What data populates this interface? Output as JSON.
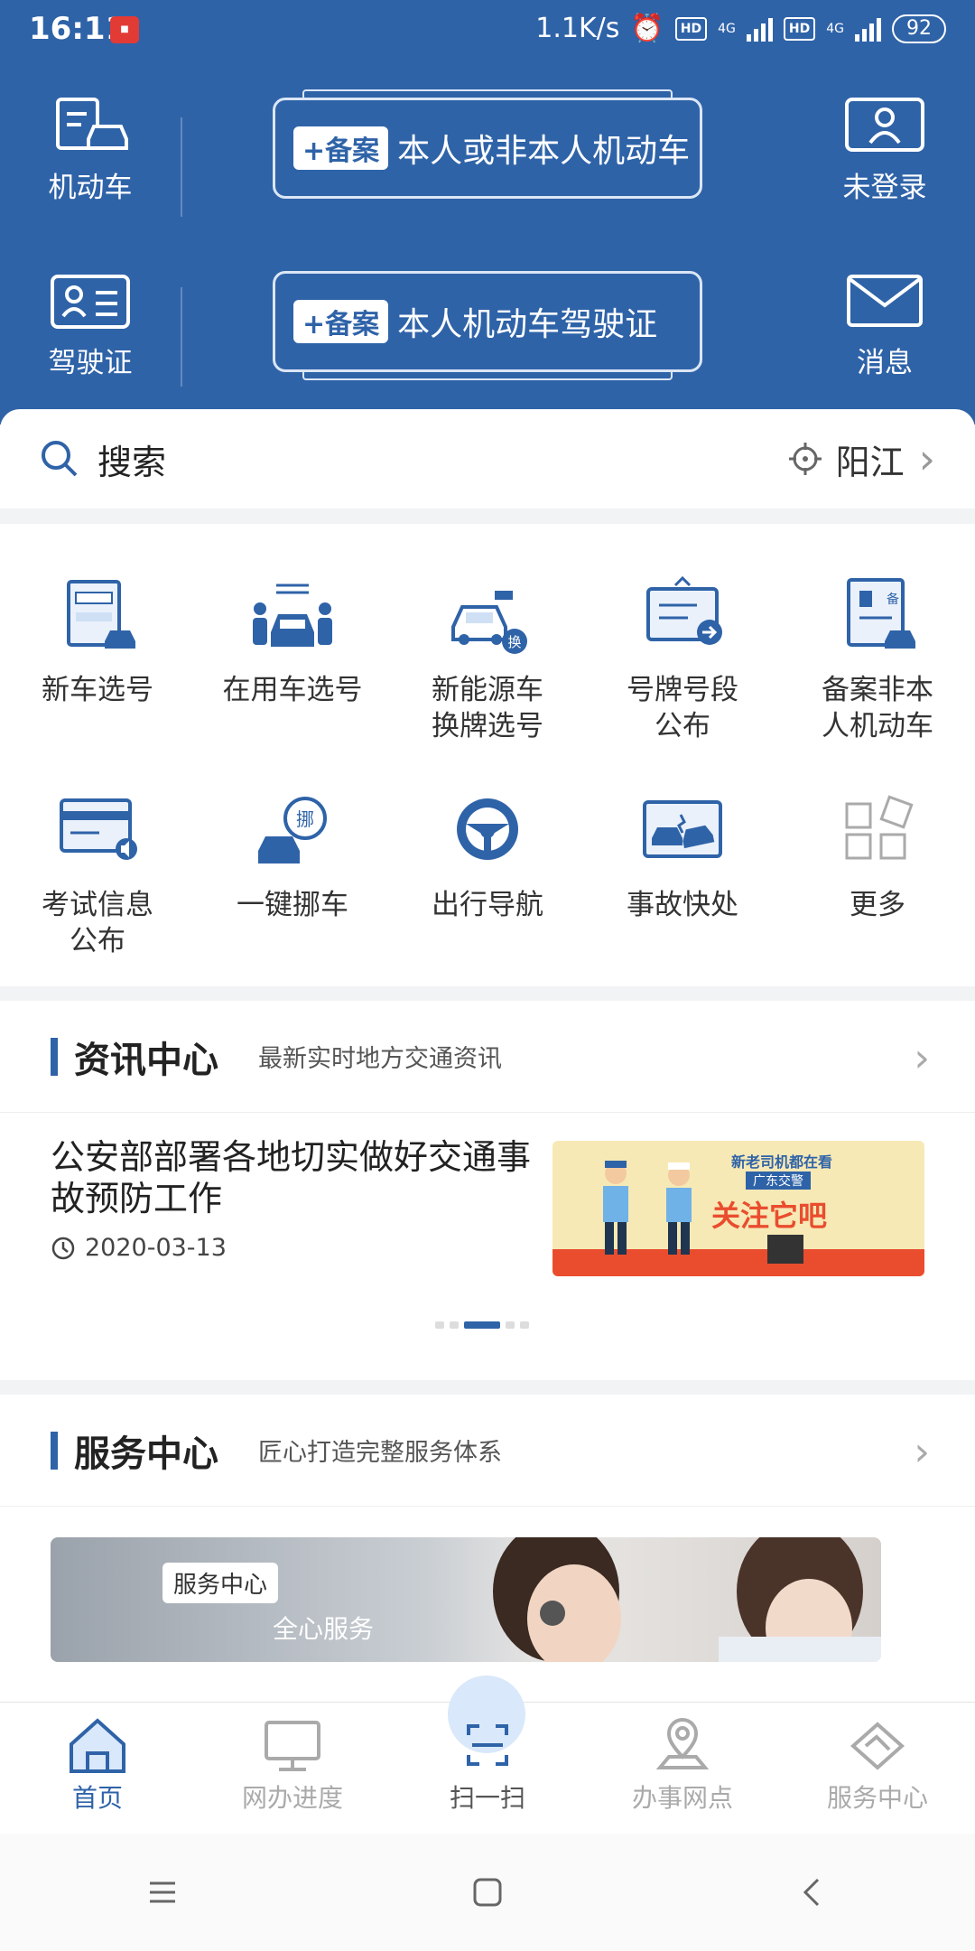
{
  "status_bar": {
    "time": "16:11",
    "net_speed": "1.1K/s",
    "battery": "92",
    "hd1": "HD",
    "hd2": "HD",
    "lte1": "4G",
    "lte2": "4G"
  },
  "header": {
    "motor_vehicle": "机动车",
    "license": "驾驶证",
    "not_logged_in": "未登录",
    "messages": "消息",
    "card1_tag": "+备案",
    "card1_text": "本人或非本人机动车",
    "card2_tag": "+备案",
    "card2_text": "本人机动车驾驶证"
  },
  "search": {
    "label": "搜索",
    "city": "阳江"
  },
  "services": [
    {
      "label": "新车选号",
      "icon": "new-car-plate-icon"
    },
    {
      "label": "在用车选号",
      "icon": "used-car-plate-icon"
    },
    {
      "label": "新能源车\n换牌选号",
      "icon": "ev-plate-exchange-icon"
    },
    {
      "label": "号牌号段\n公布",
      "icon": "plate-announcement-icon"
    },
    {
      "label": "备案非本\n人机动车",
      "icon": "register-vehicle-icon"
    },
    {
      "label": "考试信息\n公布",
      "icon": "exam-info-icon"
    },
    {
      "label": "一键挪车",
      "icon": "move-car-icon"
    },
    {
      "label": "出行导航",
      "icon": "steering-wheel-icon"
    },
    {
      "label": "事故快处",
      "icon": "accident-icon"
    },
    {
      "label": "更多",
      "icon": "more-grid-icon"
    }
  ],
  "news": {
    "title": "资讯中心",
    "subtitle": "最新实时地方交通资讯",
    "headline": "公安部部署各地切实做好交通事故预防工作",
    "date": "2020-03-13",
    "poster_top": "新老司机都在看",
    "poster_mid": "广东交警",
    "poster_main": "关注它吧"
  },
  "service_center": {
    "title": "服务中心",
    "subtitle": "匠心打造完整服务体系",
    "banner_tag": "服务中心",
    "banner_text": "全心服务"
  },
  "tabs": [
    {
      "label": "首页",
      "icon": "home-icon"
    },
    {
      "label": "网办进度",
      "icon": "monitor-icon"
    },
    {
      "label": "扫一扫",
      "icon": "scan-icon"
    },
    {
      "label": "办事网点",
      "icon": "location-icon"
    },
    {
      "label": "服务中心",
      "icon": "handshake-icon"
    }
  ],
  "colors": {
    "primary": "#2f63a8",
    "background": "#f2f3f5"
  }
}
